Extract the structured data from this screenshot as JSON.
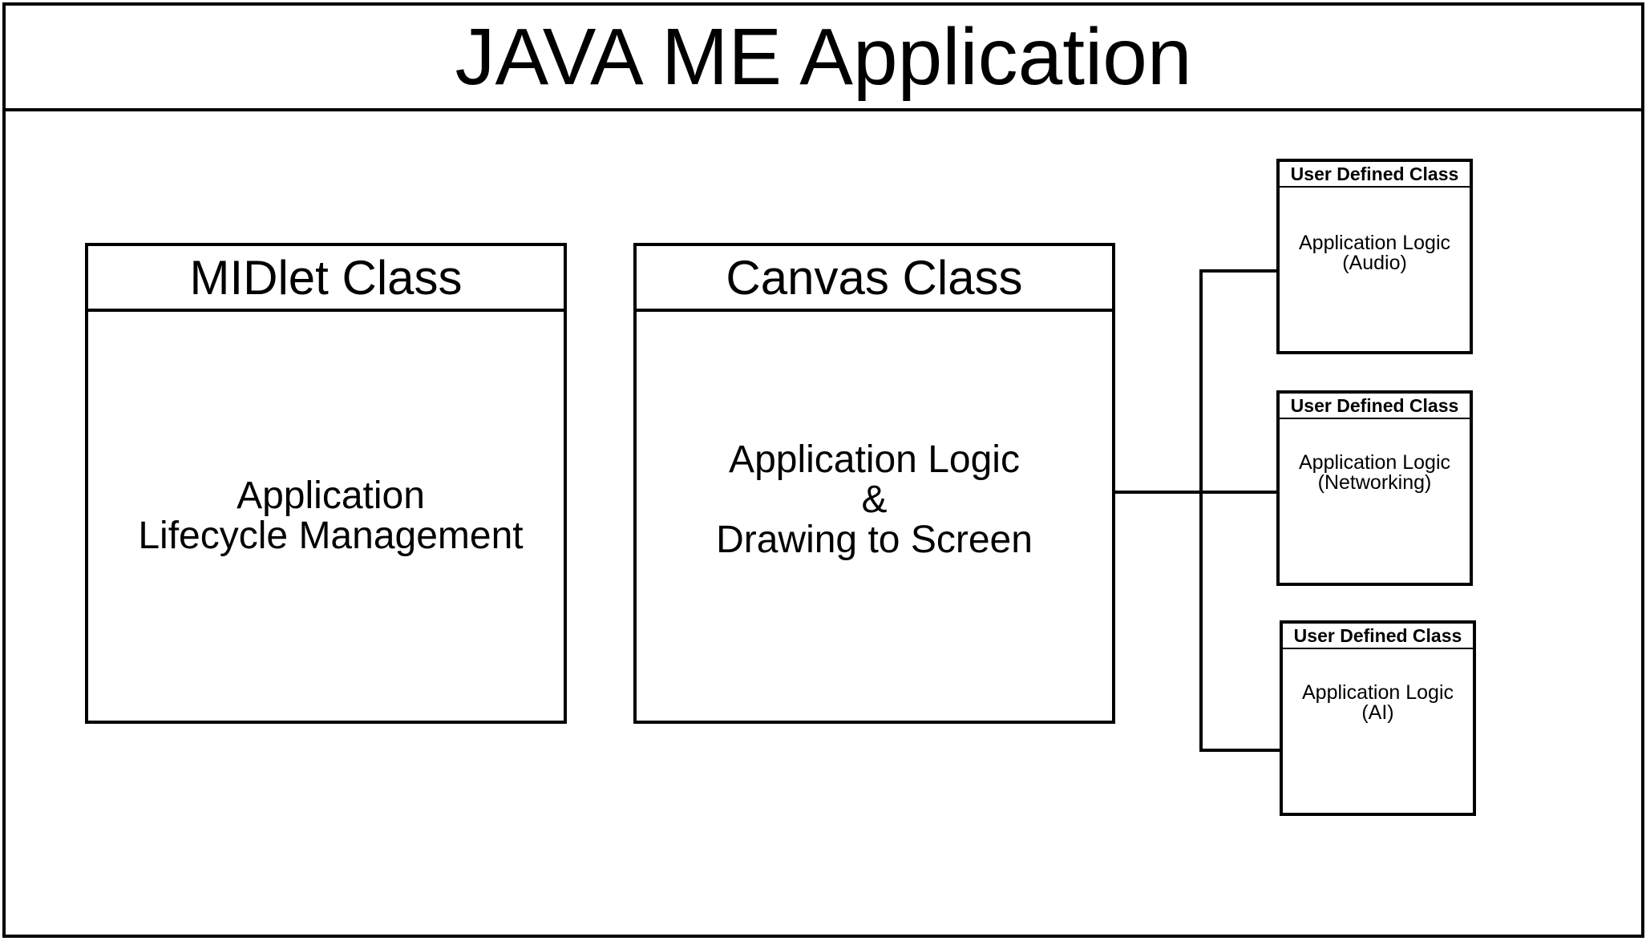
{
  "title": "JAVA ME Application",
  "midlet": {
    "header": "MIDlet Class",
    "lines": [
      "Application",
      "Lifecycle Management"
    ]
  },
  "canvas": {
    "header": "Canvas Class",
    "lines": [
      "Application Logic",
      "&",
      "Drawing to Screen"
    ]
  },
  "user_classes": [
    {
      "header": "User Defined Class",
      "lines": [
        "Application Logic",
        "(Audio)"
      ]
    },
    {
      "header": "User Defined Class",
      "lines": [
        "Application Logic",
        "(Networking)"
      ]
    },
    {
      "header": "User Defined Class",
      "lines": [
        "Application Logic",
        "(AI)"
      ]
    }
  ]
}
